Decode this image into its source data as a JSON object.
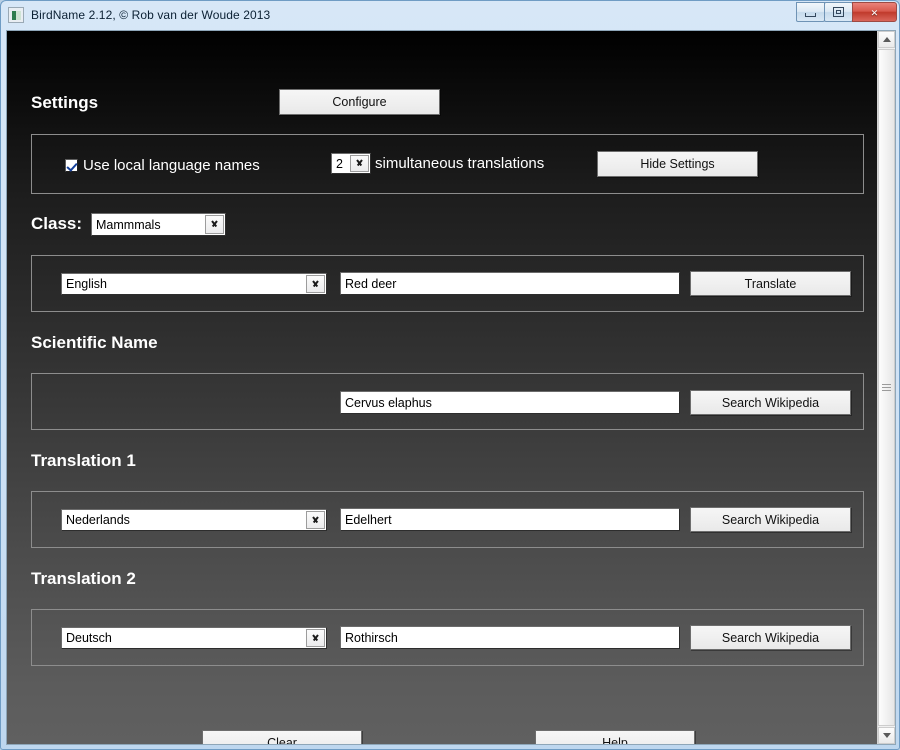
{
  "window": {
    "title": "BirdName 2.12, © Rob van der Woude 2013",
    "icon": "app-icon",
    "controls": {
      "minimize": "minimize",
      "restore": "restore",
      "close": "×"
    }
  },
  "settings": {
    "heading": "Settings",
    "configure_label": "Configure",
    "use_local_names_label": "Use local language names",
    "use_local_names_checked": true,
    "translations_count": "2",
    "translations_suffix_label": "simultaneous translations",
    "hide_settings_label": "Hide Settings"
  },
  "class_row": {
    "label": "Class:",
    "value": "Mammmals"
  },
  "source": {
    "language": "English",
    "name": "Red deer",
    "translate_label": "Translate"
  },
  "scientific": {
    "heading": "Scientific Name",
    "value": "Cervus elaphus",
    "search_label": "Search Wikipedia"
  },
  "translation1": {
    "heading": "Translation 1",
    "language": "Nederlands",
    "value": "Edelhert",
    "search_label": "Search Wikipedia"
  },
  "translation2": {
    "heading": "Translation 2",
    "language": "Deutsch",
    "value": "Rothirsch",
    "search_label": "Search Wikipedia"
  },
  "footer": {
    "clear_label": "Clear",
    "help_label": "Help"
  },
  "scrollbar": {
    "up_arrow": "scroll-up",
    "down_arrow": "scroll-down"
  }
}
